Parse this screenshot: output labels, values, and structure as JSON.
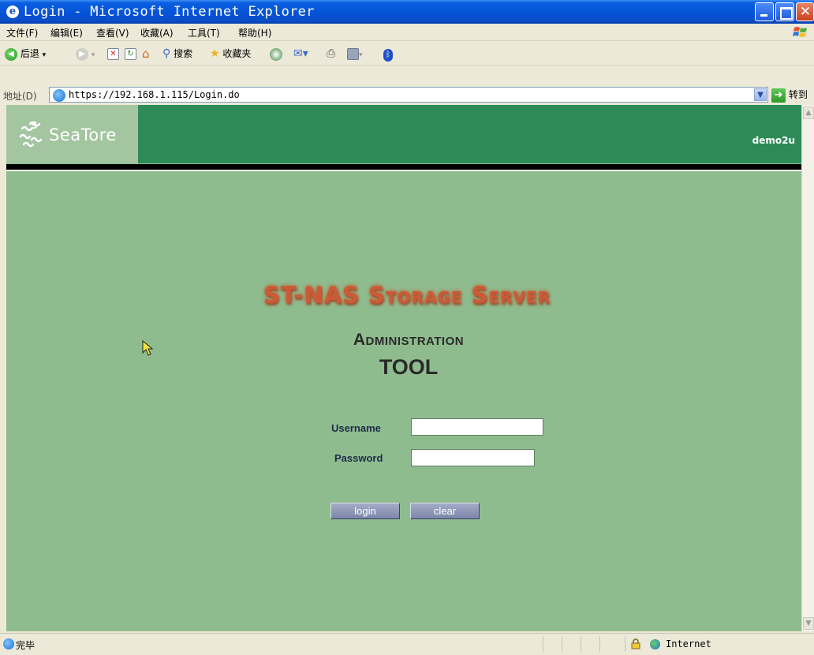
{
  "window": {
    "title": "Login - Microsoft Internet Explorer"
  },
  "menu": [
    "文件(F)",
    "编辑(E)",
    "查看(V)",
    "收藏(A)",
    "工具(T)",
    "帮助(H)"
  ],
  "toolbar": {
    "back": "后退",
    "search": "搜索",
    "favorites": "收藏夹"
  },
  "address": {
    "label": "地址(D)",
    "url": "https://192.168.1.115/Login.do",
    "go": "转到"
  },
  "page": {
    "brand": "SeaTore",
    "user": "demo2u",
    "product_title": "ST-NAS Storage Server",
    "subtitle_line1": "Administration",
    "subtitle_line2": "TOOL",
    "username_label": "Username",
    "password_label": "Password",
    "username_value": "",
    "password_value": "",
    "login_button": "login",
    "clear_button": "clear"
  },
  "status": {
    "text": "完毕",
    "zone": "Internet"
  },
  "colors": {
    "banner": "#2e8b57",
    "logo_bg": "#a3c6a1",
    "content_bg": "#8fbc8f",
    "title_orange": "#cc5a36",
    "button": "#7c86a8"
  }
}
